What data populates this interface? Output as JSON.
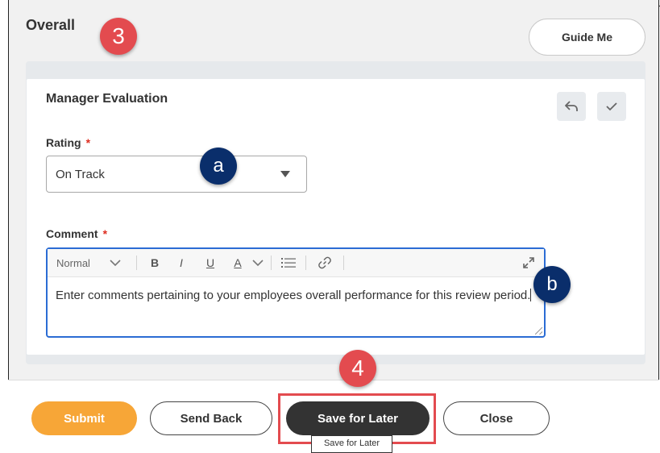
{
  "section": {
    "title": "Overall",
    "guide_label": "Guide Me"
  },
  "card": {
    "title": "Manager Evaluation",
    "rating_label": "Rating",
    "rating_value": "On Track",
    "comment_label": "Comment",
    "required_mark": "*",
    "toolbar": {
      "style": "Normal",
      "bold": "B",
      "italic": "I",
      "underline": "U",
      "font_color": "A"
    },
    "comment_text": "Enter comments pertaining to your employees overall performance for this review period."
  },
  "annotations": {
    "step3": "3",
    "step4": "4",
    "a": "a",
    "b": "b"
  },
  "footer": {
    "submit": "Submit",
    "send_back": "Send Back",
    "save_for_later": "Save for Later",
    "close": "Close",
    "tooltip": "Save for Later"
  },
  "colors": {
    "accent_orange": "#f7a637",
    "annotation_red": "#e34b4f",
    "annotation_navy": "#0a2e6b",
    "required_red": "#de2e21",
    "focus_blue": "#2b6cd4"
  },
  "icons": [
    "undo-icon",
    "checkmark-icon",
    "bulleted-list-icon",
    "link-icon",
    "expand-icon",
    "dropdown-arrow-icon",
    "chevron-down-icon"
  ]
}
